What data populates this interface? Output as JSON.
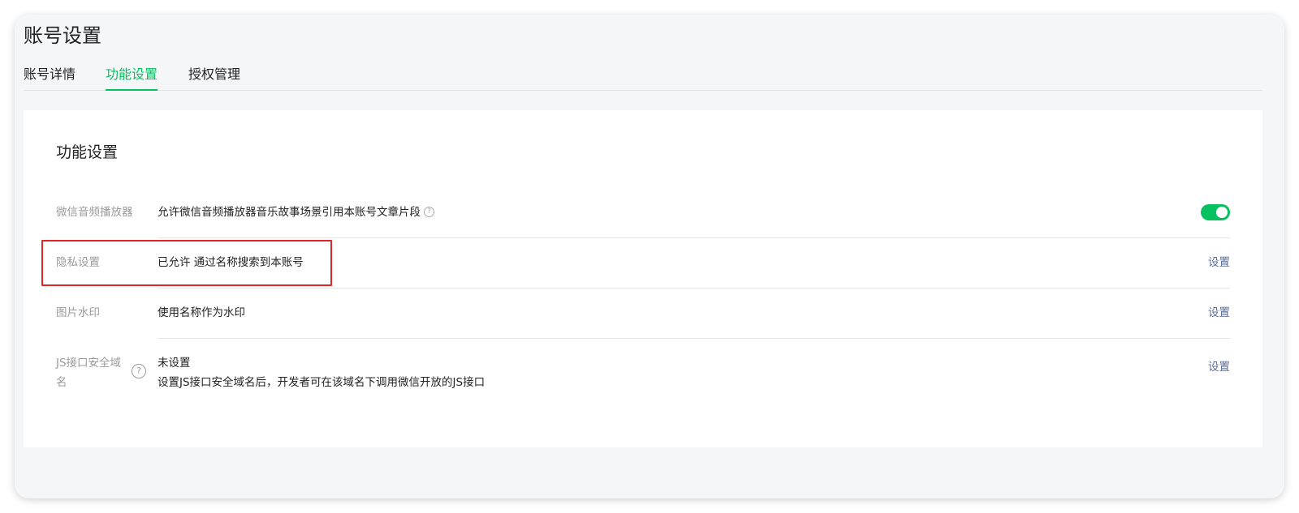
{
  "page": {
    "title": "账号设置"
  },
  "tabs": [
    {
      "label": "账号详情",
      "active": false
    },
    {
      "label": "功能设置",
      "active": true
    },
    {
      "label": "授权管理",
      "active": false
    }
  ],
  "section": {
    "title": "功能设置"
  },
  "rows": {
    "audio_player": {
      "label": "微信音频播放器",
      "value": "允许微信音频播放器音乐故事场景引用本账号文章片段",
      "help_icon": "?",
      "toggle_on": true
    },
    "privacy": {
      "label": "隐私设置",
      "value": "已允许 通过名称搜索到本账号",
      "action": "设置"
    },
    "watermark": {
      "label": "图片水印",
      "value": "使用名称作为水印",
      "action": "设置"
    },
    "js_domain": {
      "label_line1": "JS接口安全域",
      "label_line2": "名",
      "help_icon": "?",
      "value_line1": "未设置",
      "value_line2": "设置JS接口安全域名后，开发者可在该域名下调用微信开放的JS接口",
      "action": "设置"
    }
  },
  "colors": {
    "accent_green": "#07c160",
    "link_blue": "#576b95",
    "highlight_red": "#e02525"
  }
}
